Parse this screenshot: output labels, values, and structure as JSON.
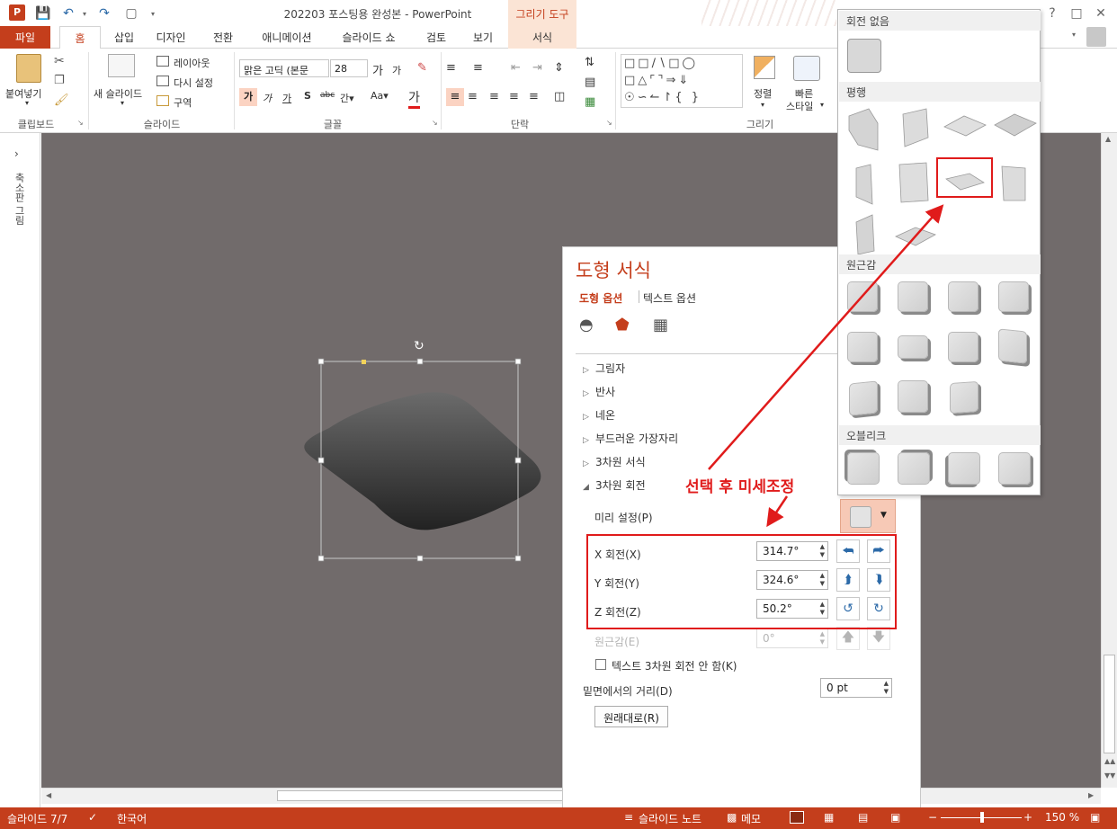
{
  "window": {
    "title": "202203 포스팅용 완성본 - PowerPoint",
    "context_tab_header": "그리기 도구"
  },
  "tabs": [
    "파일",
    "홈",
    "삽입",
    "디자인",
    "전환",
    "애니메이션",
    "슬라이드 쇼",
    "검토",
    "보기",
    "서식"
  ],
  "ribbon": {
    "clipboard": {
      "paste": "붙여넣기",
      "label": "클립보드"
    },
    "slides": {
      "new_slide": "새 슬라이드",
      "layout": "레이아웃",
      "reset": "다시 설정",
      "section": "구역",
      "label": "슬라이드"
    },
    "font": {
      "font_name": "맑은 고딕 (본문",
      "font_size": "28",
      "label": "글꼴"
    },
    "paragraph": {
      "label": "단락"
    },
    "drawing": {
      "arrange": "정렬",
      "quick_styles_1": "빠른",
      "quick_styles_2": "스타일",
      "label": "그리기"
    }
  },
  "thumb_strip": {
    "label": "축소판 그림"
  },
  "pane": {
    "title": "도형 서식",
    "tab_shape": "도형 옵션",
    "tab_text": "텍스트 옵션",
    "sections": [
      "그림자",
      "반사",
      "네온",
      "부드러운 가장자리",
      "3차원 서식"
    ],
    "rotation_section": "3차원 회전",
    "preset_label": "미리 설정(P)",
    "x_label": "X 회전(X)",
    "x_value": "314.7°",
    "y_label": "Y 회전(Y)",
    "y_value": "324.6°",
    "z_label": "Z 회전(Z)",
    "z_value": "50.2°",
    "perspective_label": "원근감(E)",
    "perspective_value": "0°",
    "keep_text_flat": "텍스트 3차원 회전 안 함(K)",
    "distance_label": "밑면에서의 거리(D)",
    "distance_value": "0 pt",
    "reset_button": "원래대로(R)"
  },
  "gallery": {
    "no_rotation": "회전 없음",
    "parallel": "평행",
    "perspective": "원근감",
    "oblique": "오블리크"
  },
  "annotation": {
    "text": "선택 후 미세조정",
    "color": "#e01b1b"
  },
  "statusbar": {
    "slide": "슬라이드 7/7",
    "language": "한국어",
    "notes": "슬라이드 노트",
    "comments": "메모",
    "zoom": "150 %"
  },
  "colors": {
    "accent": "#c43e1c",
    "canvas": "#716b6b",
    "context_tab": "#fbe4d5"
  }
}
